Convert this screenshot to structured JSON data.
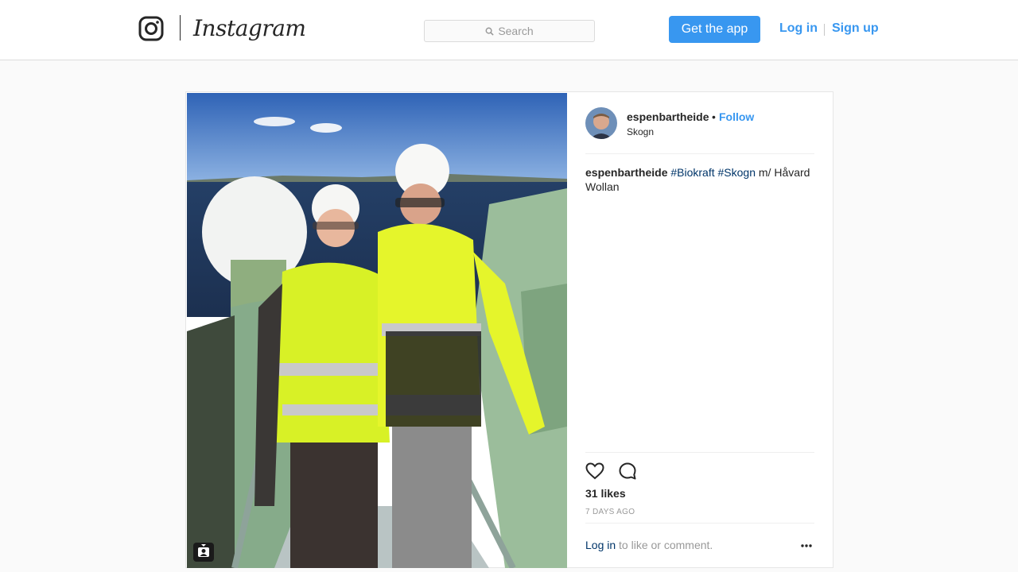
{
  "header": {
    "logo_text": "Instagram",
    "search_placeholder": "Search",
    "get_app_label": "Get the app",
    "login_label": "Log in",
    "signup_label": "Sign up",
    "accent_color": "#3897f0"
  },
  "post": {
    "username": "espenbartheide",
    "separator": "•",
    "follow_label": "Follow",
    "location": "Skogn",
    "caption": {
      "username": "espenbartheide",
      "hashtag1": "#Biokraft",
      "hashtag2": "#Skogn",
      "text": "m/ Håvard Wollan"
    },
    "likes": "31 likes",
    "posted_ago": "7 DAYS AGO",
    "login_link": "Log in",
    "login_suffix": "to like or comment.",
    "icons": {
      "like": "heart-icon",
      "comment": "comment-icon",
      "more": "more-options-icon",
      "tagged": "tagged-user-icon"
    }
  }
}
